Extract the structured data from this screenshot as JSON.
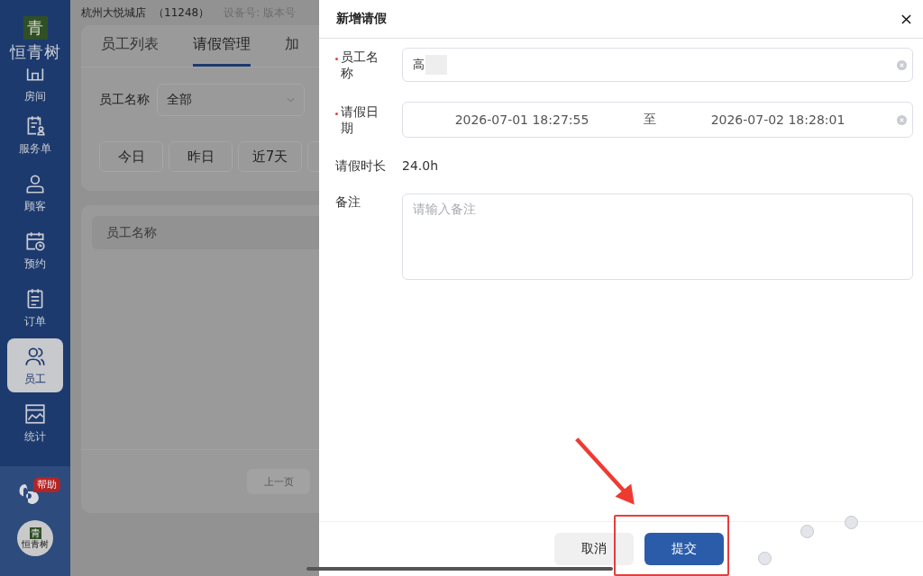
{
  "sidebar": {
    "logo_mark": "青",
    "logo_text": "恒青树",
    "items": [
      {
        "label": "房间",
        "selected": false
      },
      {
        "label": "服务单",
        "selected": false
      },
      {
        "label": "顾客",
        "selected": false
      },
      {
        "label": "预约",
        "selected": false
      },
      {
        "label": "订单",
        "selected": false
      },
      {
        "label": "员工",
        "selected": true
      },
      {
        "label": "统计",
        "selected": false
      }
    ],
    "help_badge": "帮助",
    "avatar_mark": "青",
    "avatar_text": "恒青树"
  },
  "header": {
    "store": "杭州大悦城店",
    "store_code": "（11248）",
    "device": "设备号: 版本号"
  },
  "tabs": [
    {
      "label": "员工列表",
      "selected": false
    },
    {
      "label": "请假管理",
      "selected": true
    },
    {
      "label": "加",
      "selected": false
    }
  ],
  "filter": {
    "label": "员工名称",
    "value": "全部"
  },
  "date_buttons": [
    "今日",
    "昨日",
    "近7天"
  ],
  "table": {
    "columns": [
      "员工名称"
    ]
  },
  "pagination": {
    "prev": "上一页"
  },
  "dialog": {
    "title": "新增请假",
    "fields": [
      {
        "kind": "select",
        "label": "员工名称",
        "required": true,
        "value": "高",
        "redacted": true
      },
      {
        "kind": "range",
        "label": "请假日期",
        "required": true,
        "start": "2026-07-01 18:27:55",
        "separator": "至",
        "end": "2026-07-02 18:28:01"
      },
      {
        "kind": "text",
        "label": "请假时长",
        "required": false,
        "value": "24.0h"
      },
      {
        "kind": "textarea",
        "label": "备注",
        "required": false,
        "placeholder": "请输入备注"
      }
    ],
    "buttons": [
      {
        "label": "取消",
        "primary": false
      },
      {
        "label": "提交",
        "primary": true
      }
    ]
  }
}
